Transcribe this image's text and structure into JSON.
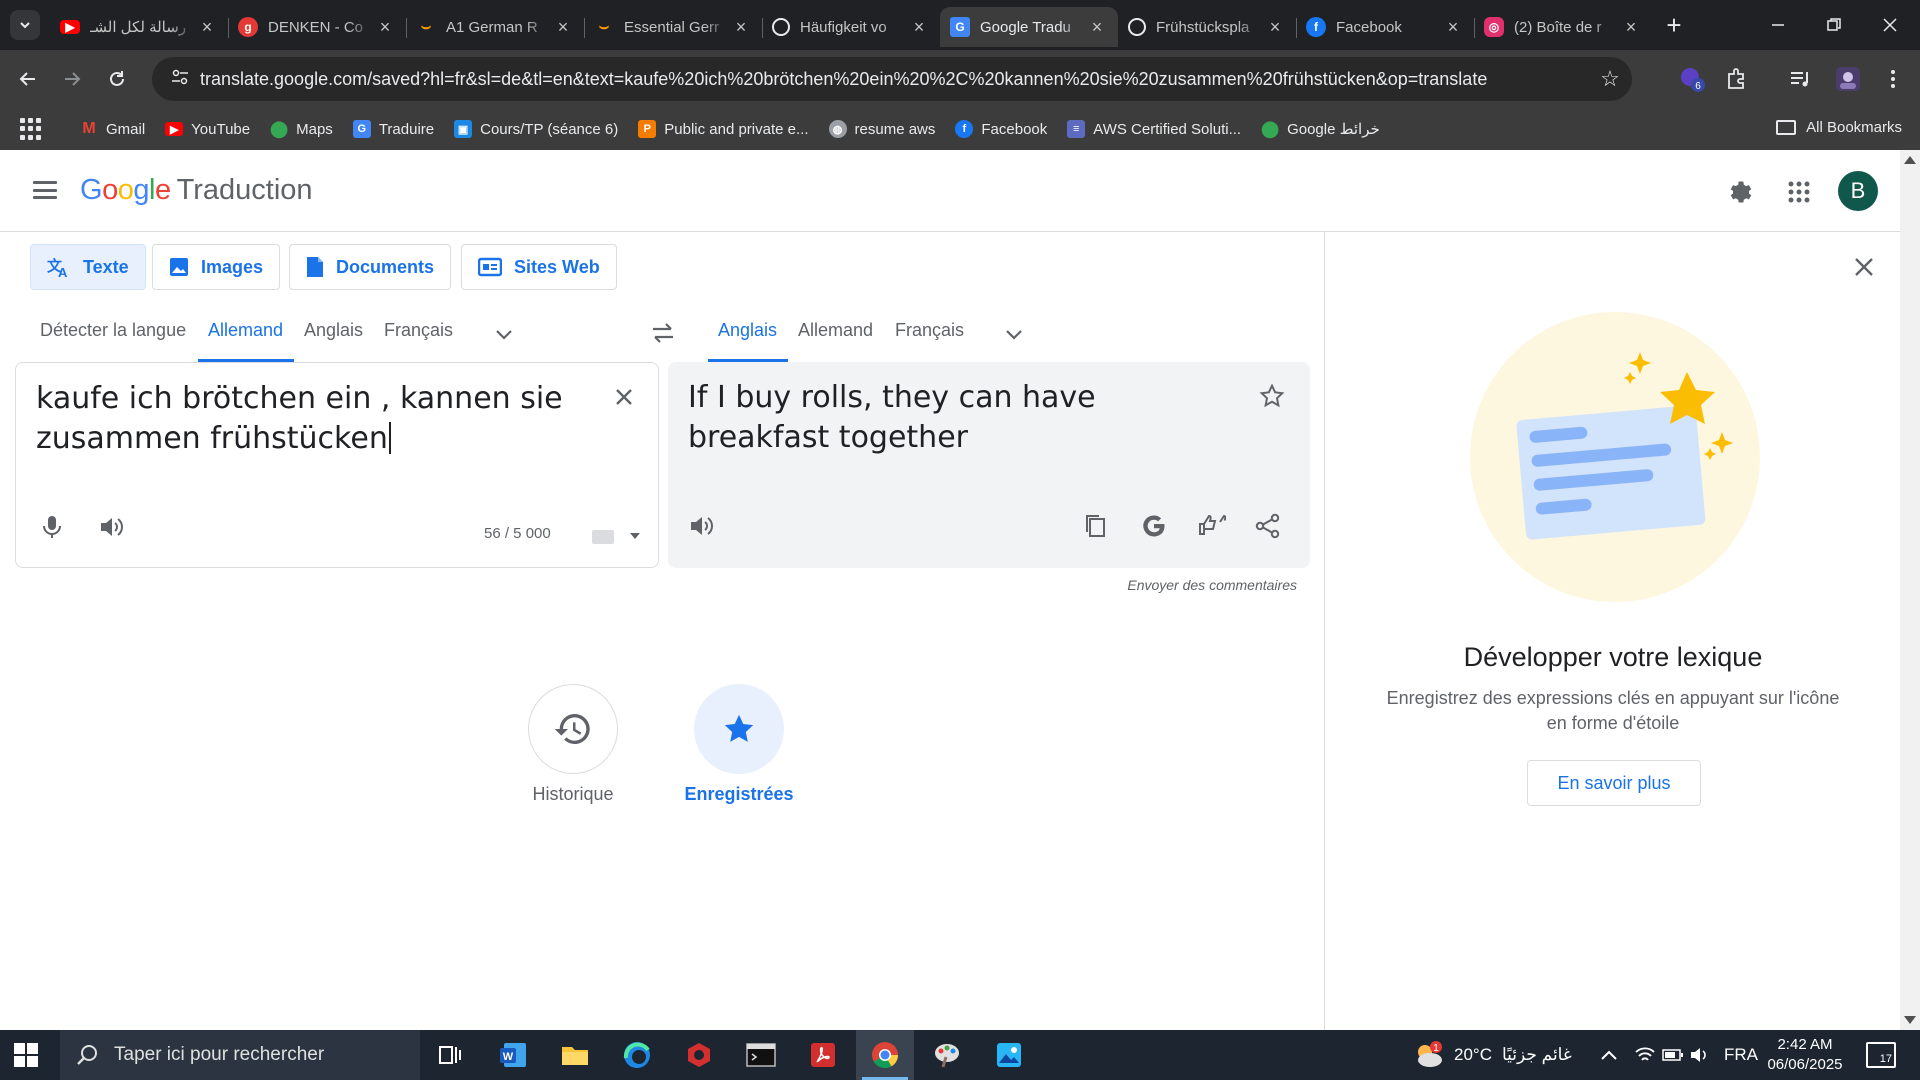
{
  "browser": {
    "tabs": [
      {
        "title": "رسالة لكل الشـ",
        "favicon": "youtube-icon",
        "color": "#ff0000"
      },
      {
        "title": "DENKEN - Co",
        "favicon": "g-icon",
        "color": "#e53935"
      },
      {
        "title": "A1 German R",
        "favicon": "amazon-icon",
        "color": "#ff9900"
      },
      {
        "title": "Essential Gerr",
        "favicon": "amazon-icon",
        "color": "#ff9900"
      },
      {
        "title": "Häufigkeit vo",
        "favicon": "chatgpt-icon",
        "color": "#ffffff"
      },
      {
        "title": "Google Tradu",
        "favicon": "google-translate-icon",
        "color": "#4285f4",
        "active": true
      },
      {
        "title": "Frühstückspla",
        "favicon": "chatgpt-icon",
        "color": "#ffffff"
      },
      {
        "title": "Facebook",
        "favicon": "facebook-icon",
        "color": "#1877f2"
      },
      {
        "title": "(2) Boîte de r",
        "favicon": "instagram-icon",
        "color": "#e1306c"
      }
    ],
    "url": "translate.google.com/saved?hl=fr&sl=de&tl=en&text=kaufe%20ich%20brötchen%20ein%20%2C%20kannen%20sie%20zusammen%20frühstücken&op=translate",
    "extension_badge": "6",
    "bookmarks": [
      {
        "label": "Gmail",
        "icon": "gmail-icon",
        "color": "#ea4335"
      },
      {
        "label": "YouTube",
        "icon": "youtube-icon",
        "color": "#ff0000"
      },
      {
        "label": "Maps",
        "icon": "maps-icon",
        "color": "#34a853"
      },
      {
        "label": "Traduire",
        "icon": "google-translate-icon",
        "color": "#4285f4"
      },
      {
        "label": "Cours/TP (séance 6)",
        "icon": "classroom-icon",
        "color": "#1e88e5"
      },
      {
        "label": "Public and private e...",
        "icon": "slides-icon",
        "color": "#f57c00"
      },
      {
        "label": "resume aws",
        "icon": "globe-icon",
        "color": "#9aa0a6"
      },
      {
        "label": "Facebook",
        "icon": "facebook-icon",
        "color": "#1877f2"
      },
      {
        "label": "AWS Certified Soluti...",
        "icon": "aws-icon",
        "color": "#5c6bc0"
      },
      {
        "label": "Google خرائط",
        "icon": "maps-icon",
        "color": "#34a853"
      }
    ],
    "all_bookmarks": "All Bookmarks"
  },
  "app": {
    "logo_google": "Google",
    "logo_product": "Traduction",
    "avatar_letter": "B",
    "modes": [
      {
        "label": "Texte",
        "icon": "translate-icon",
        "active": true
      },
      {
        "label": "Images",
        "icon": "image-icon"
      },
      {
        "label": "Documents",
        "icon": "document-icon"
      },
      {
        "label": "Sites Web",
        "icon": "website-icon"
      }
    ],
    "source_langs": [
      {
        "label": "Détecter la langue"
      },
      {
        "label": "Allemand",
        "active": true
      },
      {
        "label": "Anglais"
      },
      {
        "label": "Français"
      }
    ],
    "target_langs": [
      {
        "label": "Anglais",
        "active": true
      },
      {
        "label": "Allemand"
      },
      {
        "label": "Français"
      }
    ],
    "source_text": "kaufe ich brötchen ein , kannen sie zusammen frühstücken",
    "char_count": "56 / 5 000",
    "target_text": "If I buy rolls, they can have breakfast together",
    "feedback": "Envoyer des commentaires",
    "history_label": "Historique",
    "saved_label": "Enregistrées"
  },
  "side_panel": {
    "title": "Développer votre lexique",
    "description": "Enregistrez des expressions clés en appuyant sur l'icône en forme d'étoile",
    "button": "En savoir plus"
  },
  "taskbar": {
    "search_placeholder": "Taper ici pour rechercher",
    "weather_temp": "20°C",
    "weather_text": "غائم جزئيًا",
    "weather_badge": "1",
    "language": "FRA",
    "time": "2:42 AM",
    "date": "06/06/2025",
    "notifications": "17"
  },
  "colors": {
    "accent": "#1a73e8",
    "chrome_dark": "#202124",
    "taskbar": "#1c2530"
  }
}
